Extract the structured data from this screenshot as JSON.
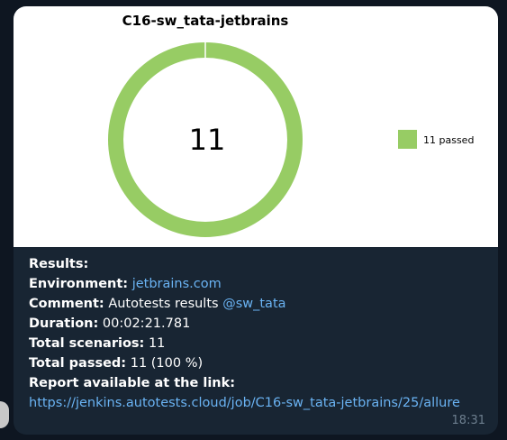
{
  "chart_data": {
    "type": "pie",
    "title": "C16-sw_tata-jetbrains",
    "center_label": "11",
    "slices": [
      {
        "label": "11 passed",
        "value": 11,
        "color": "#97cc64"
      }
    ]
  },
  "message": {
    "results_label": "Results:",
    "environment_label": "Environment:",
    "environment_value": "jetbrains.com",
    "comment_label": "Comment:",
    "comment_text": "Autotests results",
    "comment_mention": "@sw_tata",
    "duration_label": "Duration:",
    "duration_value": "00:02:21.781",
    "total_scenarios_label": "Total scenarios:",
    "total_scenarios_value": "11",
    "total_passed_label": "Total passed:",
    "total_passed_value": "11 (100 %)",
    "report_label": "Report available at the link:",
    "report_link": "https://jenkins.autotests.cloud/job/C16-sw_tata-jetbrains/25/allure",
    "time": "18:31"
  }
}
